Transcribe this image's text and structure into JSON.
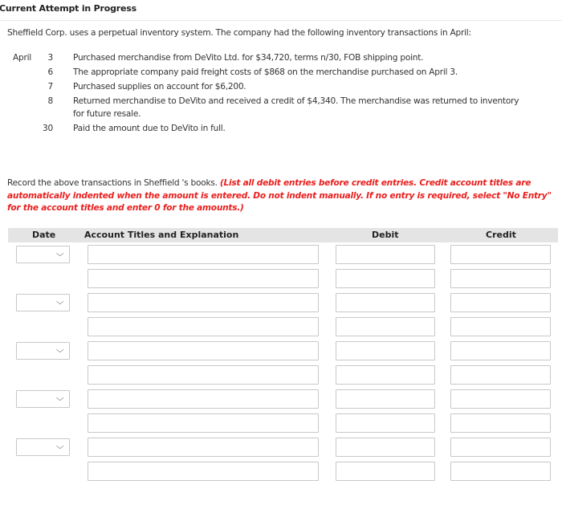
{
  "header": {
    "title": "Current Attempt in Progress"
  },
  "problem": {
    "intro": "Sheffield Corp. uses a perpetual inventory system. The company had the following inventory transactions in April:",
    "transactions": [
      {
        "month": "April",
        "day": "3",
        "description": "Purchased merchandise from DeVito Ltd. for $34,720, terms n/30, FOB shipping point."
      },
      {
        "month": "",
        "day": "6",
        "description": "The appropriate company paid freight costs of $868 on the merchandise purchased on April 3."
      },
      {
        "month": "",
        "day": "7",
        "description": "Purchased supplies on account for $6,200."
      },
      {
        "month": "",
        "day": "8",
        "description": "Returned merchandise to DeVito and received a credit of $4,340. The merchandise was returned to inventory",
        "description_line2": "for future resale."
      },
      {
        "month": "",
        "day": "30",
        "description": "Paid the amount due to DeVito in full."
      }
    ],
    "instructions_plain": "Record the above transactions in Sheffield 's books. ",
    "instructions_note": "(List all debit entries before credit entries. Credit account titles are automatically indented when the amount is entered. Do not indent manually. If no entry is required, select \"No Entry\" for the account titles and enter 0 for the amounts.)"
  },
  "journal": {
    "columns": {
      "date": "Date",
      "account": "Account Titles and Explanation",
      "debit": "Debit",
      "credit": "Credit"
    },
    "rows": [
      {
        "has_date": true,
        "date": "",
        "account": "",
        "debit": "",
        "credit": ""
      },
      {
        "has_date": false,
        "date": "",
        "account": "",
        "debit": "",
        "credit": ""
      },
      {
        "has_date": true,
        "date": "",
        "account": "",
        "debit": "",
        "credit": ""
      },
      {
        "has_date": false,
        "date": "",
        "account": "",
        "debit": "",
        "credit": ""
      },
      {
        "has_date": true,
        "date": "",
        "account": "",
        "debit": "",
        "credit": ""
      },
      {
        "has_date": false,
        "date": "",
        "account": "",
        "debit": "",
        "credit": ""
      },
      {
        "has_date": true,
        "date": "",
        "account": "",
        "debit": "",
        "credit": ""
      },
      {
        "has_date": false,
        "date": "",
        "account": "",
        "debit": "",
        "credit": ""
      },
      {
        "has_date": true,
        "date": "",
        "account": "",
        "debit": "",
        "credit": ""
      },
      {
        "has_date": false,
        "date": "",
        "account": "",
        "debit": "",
        "credit": ""
      }
    ]
  },
  "colors": {
    "note_red": "#e8201e",
    "header_bg": "#e4e4e4",
    "field_border": "#c8c8c8"
  },
  "icons": {
    "date_dropdown": "chevron-down-icon"
  }
}
